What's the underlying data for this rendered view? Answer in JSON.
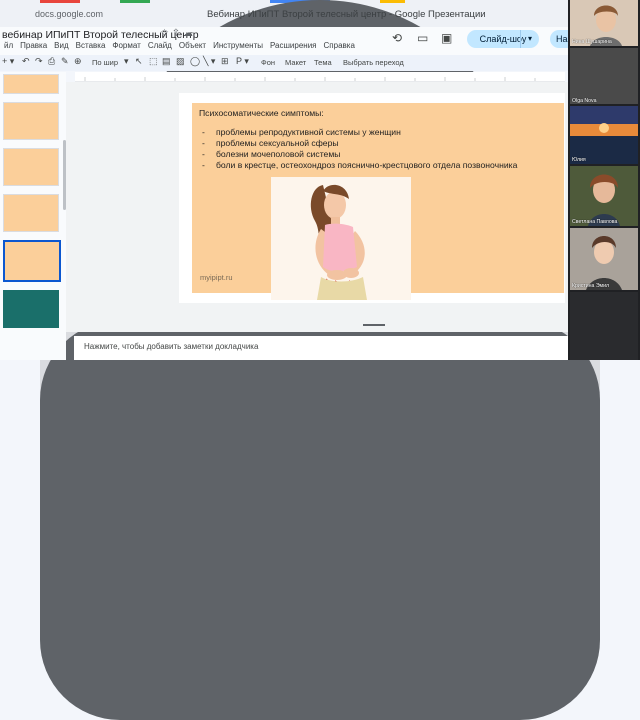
{
  "browser": {
    "url": "docs.google.com",
    "window_title": "Вебинар ИПиПТ Второй телесный центр - Google Презентации"
  },
  "app": {
    "doc_title": "вебинар ИПиПТ Второй телесный центр",
    "menu": [
      "йл",
      "Правка",
      "Вид",
      "Вставка",
      "Формат",
      "Слайд",
      "Объект",
      "Инструменты",
      "Расширения",
      "Справка"
    ],
    "slideshow_label": "Слайд-шоу",
    "share_label": "На"
  },
  "toolbar": {
    "zoom": "По шир",
    "background": "Фон",
    "layout": "Макет",
    "theme": "Тема",
    "transition": "Выбрать переход"
  },
  "slide": {
    "heading": "Психосоматические симптомы:",
    "bullets": [
      "проблемы репродуктивной системы у женщин",
      "проблемы сексуальной сферы",
      "болезни мочеполовой системы",
      "боли в крестце, остеохондроз пояснично-крестцового отдела позвоночника"
    ],
    "watermark": "myipipt.ru"
  },
  "notes": {
    "placeholder": "Нажмите, чтобы добавить заметки докладчика"
  },
  "participants": [
    "Нина Шушарина",
    "Olga Nova",
    "Юлия",
    "Светлана Павлова",
    "Кристина Эмил"
  ],
  "colors": {
    "slide_background": "#fbcf9a",
    "slideshow_button": "#c2e7ff",
    "selection": "#0b57d0"
  }
}
